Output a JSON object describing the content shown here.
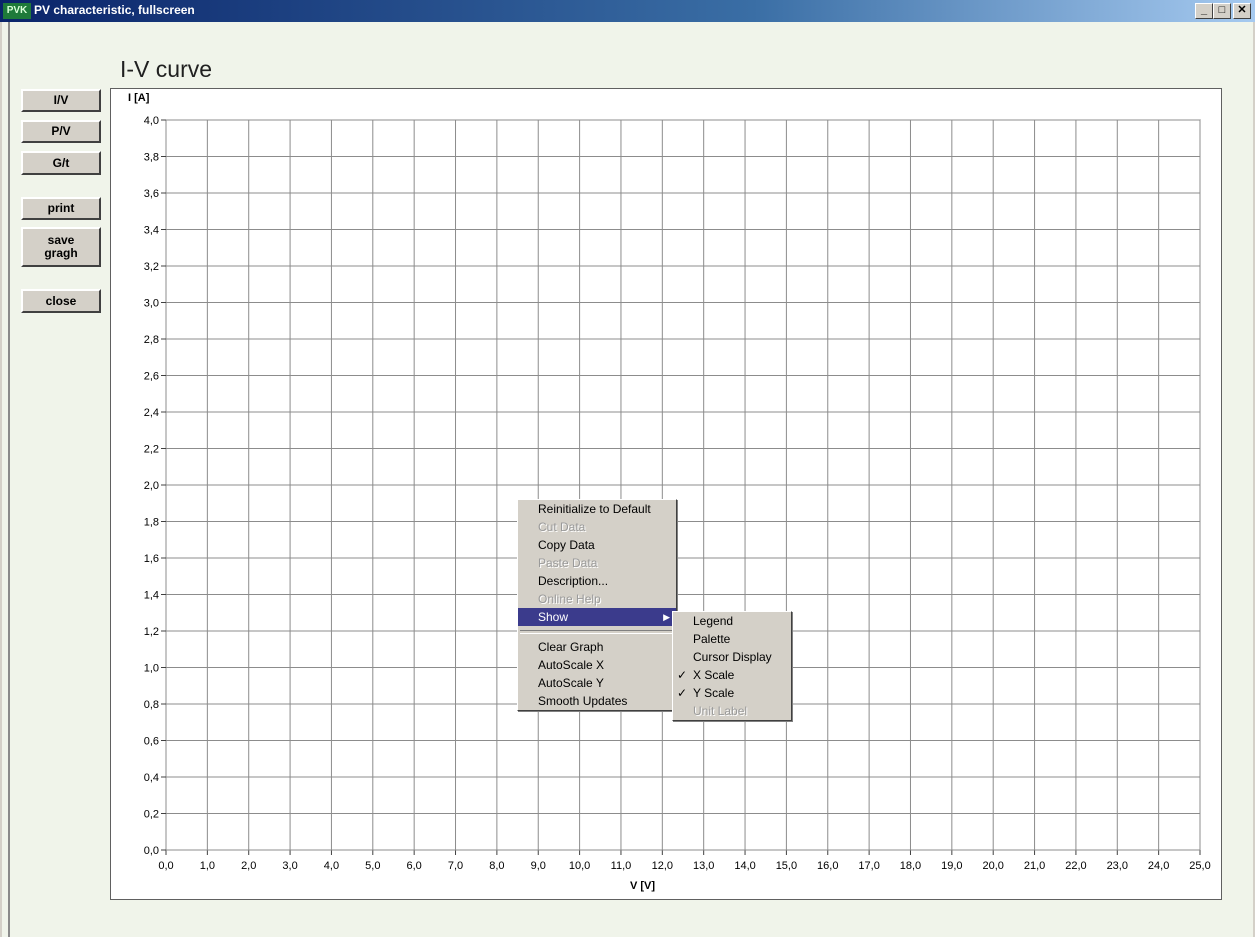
{
  "window": {
    "app_icon": "PVK",
    "title": "PV characteristic, fullscreen",
    "minimize": "_",
    "maximize": "□",
    "close": "✕"
  },
  "graph": {
    "title": "I-V curve"
  },
  "side_buttons": {
    "iv": "I/V",
    "pv": "P/V",
    "gt": "G/t",
    "print": "print",
    "save_graph": "save gragh",
    "close": "close"
  },
  "chart_data": {
    "type": "line",
    "title": "I-V curve",
    "xlabel": "V [V]",
    "ylabel": "I [A]",
    "xlim": [
      0,
      25
    ],
    "ylim": [
      0,
      4
    ],
    "x_ticks": [
      "0,0",
      "1,0",
      "2,0",
      "3,0",
      "4,0",
      "5,0",
      "6,0",
      "7,0",
      "8,0",
      "9,0",
      "10,0",
      "11,0",
      "12,0",
      "13,0",
      "14,0",
      "15,0",
      "16,0",
      "17,0",
      "18,0",
      "19,0",
      "20,0",
      "21,0",
      "22,0",
      "23,0",
      "24,0",
      "25,0"
    ],
    "y_ticks": [
      "0,0",
      "0,2",
      "0,4",
      "0,6",
      "0,8",
      "1,0",
      "1,2",
      "1,4",
      "1,6",
      "1,8",
      "2,0",
      "2,2",
      "2,4",
      "2,6",
      "2,8",
      "3,0",
      "3,2",
      "3,4",
      "3,6",
      "3,8",
      "4,0"
    ],
    "grid": true,
    "series": []
  },
  "context_menu": {
    "items": [
      {
        "label": "Reinitialize to Default",
        "enabled": true
      },
      {
        "label": "Cut Data",
        "enabled": false
      },
      {
        "label": "Copy Data",
        "enabled": true
      },
      {
        "label": "Paste Data",
        "enabled": false
      },
      {
        "label": "Description...",
        "enabled": true
      },
      {
        "label": "Online Help",
        "enabled": false
      },
      {
        "label": "Show",
        "enabled": true,
        "selected": true
      },
      {
        "label": "Clear Graph",
        "enabled": true
      },
      {
        "label": "AutoScale X",
        "enabled": true
      },
      {
        "label": "AutoScale Y",
        "enabled": true
      },
      {
        "label": "Smooth Updates",
        "enabled": true
      }
    ]
  },
  "show_submenu": {
    "items": [
      {
        "label": "Legend",
        "checked": false,
        "enabled": true
      },
      {
        "label": "Palette",
        "checked": false,
        "enabled": true
      },
      {
        "label": "Cursor Display",
        "checked": false,
        "enabled": true
      },
      {
        "label": "X Scale",
        "checked": true,
        "enabled": true
      },
      {
        "label": "Y Scale",
        "checked": true,
        "enabled": true
      },
      {
        "label": "Unit Label",
        "checked": false,
        "enabled": false
      }
    ],
    "check_glyph": "✓",
    "arrow_glyph": "▶"
  }
}
